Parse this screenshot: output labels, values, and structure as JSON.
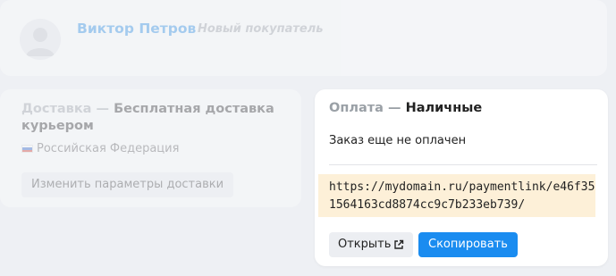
{
  "customer": {
    "name": "Виктор Петров",
    "tag": "Новый покупатель"
  },
  "delivery": {
    "label": "Доставка",
    "separator": " — ",
    "method": "Бесплатная доставка курьером",
    "country": "Российская Федерация",
    "change_button": "Изменить параметры доставки"
  },
  "payment": {
    "label": "Оплата",
    "separator": " — ",
    "method": "Наличные",
    "status": "Заказ еще не оплачен",
    "link": "https://mydomain.ru/paymentlink/e46f351564163cd8874cc9c7b233eb739/",
    "open_button": "Открыть",
    "copy_button": "Скопировать"
  },
  "colors": {
    "accent": "#1a8cf0",
    "link_bg": "#fdf0d8"
  }
}
